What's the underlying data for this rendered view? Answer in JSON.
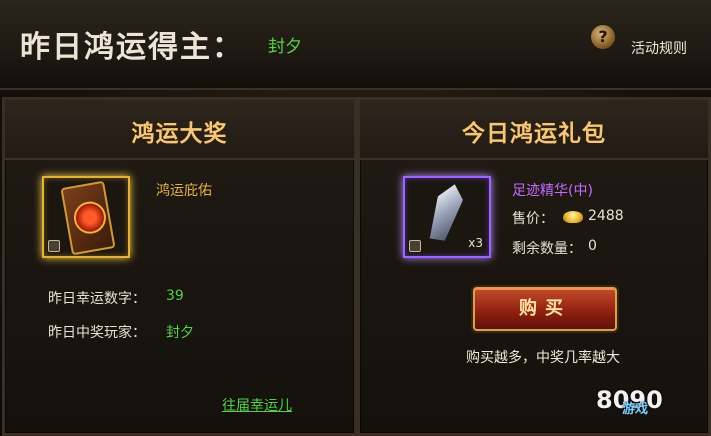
{
  "header": {
    "title": "昨日鸿运得主：",
    "winner_name": "封夕",
    "help_icon": "?",
    "rules_label": "活动规则"
  },
  "left_panel": {
    "title": "鸿运大奖",
    "item": {
      "name": "鸿运庇佑",
      "icon": "fortune-card-icon"
    },
    "stats": [
      {
        "label": "昨日幸运数字：",
        "value": "39"
      },
      {
        "label": "昨日中奖玩家：",
        "value": "封夕"
      }
    ],
    "history_link": "往届幸运儿"
  },
  "right_panel": {
    "title": "今日鸿运礼包",
    "item": {
      "name": "足迹精华(中)",
      "icon": "crystal-icon",
      "quantity": "x3"
    },
    "price_label": "售价：",
    "price_value": "2488",
    "remaining_label": "剩余数量：",
    "remaining_value": "0",
    "buy_button": "购买",
    "note": "购买越多，中奖几率越大"
  },
  "watermark": {
    "logo_text": "8090",
    "site_text": "游戏"
  },
  "colors": {
    "gold": "#f4c87a",
    "green": "#54d04a",
    "purple": "#c56bff",
    "button_red": "#8c1f10"
  }
}
